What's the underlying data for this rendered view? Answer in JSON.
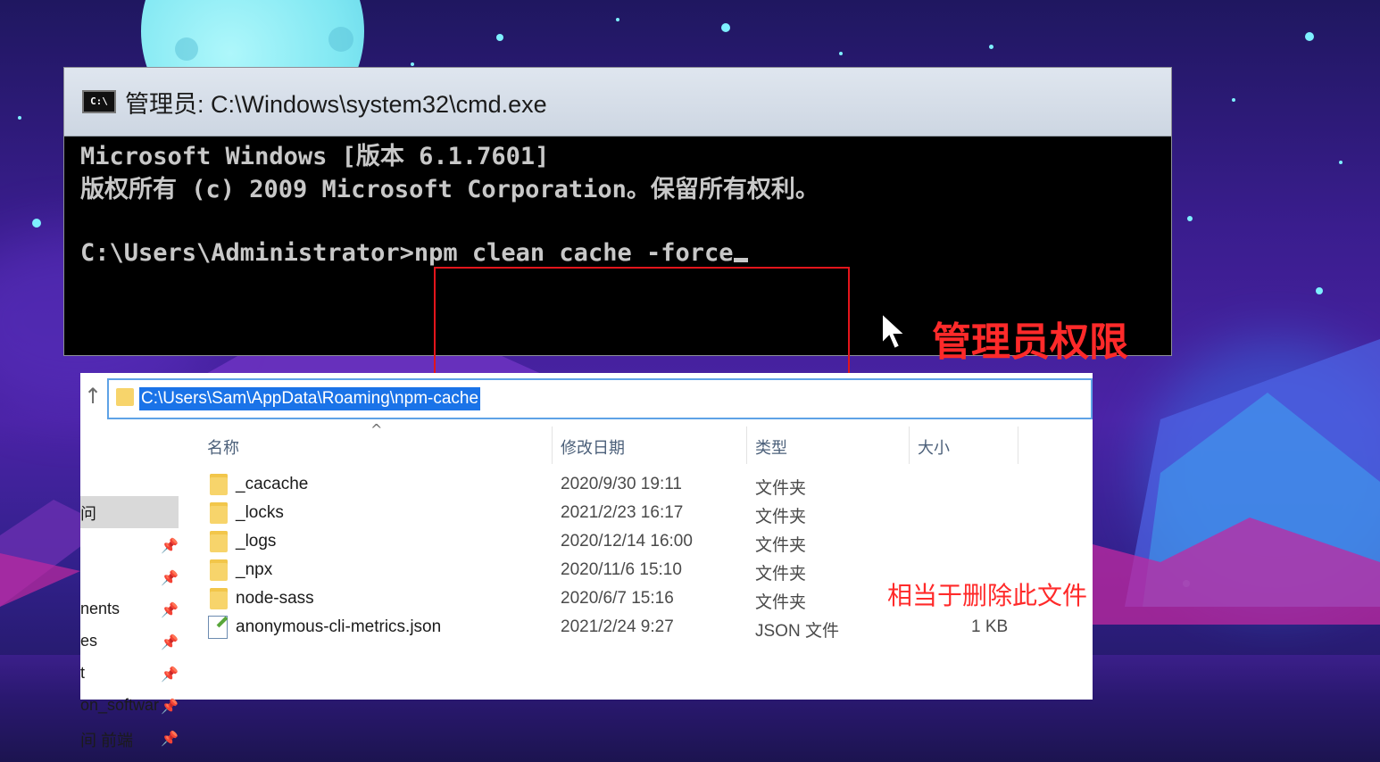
{
  "cmd": {
    "title": "管理员: C:\\Windows\\system32\\cmd.exe",
    "icon_label": "C:\\",
    "lines": [
      "Microsoft Windows [版本 6.1.7601]",
      "版权所有 (c) 2009 Microsoft Corporation。保留所有权利。",
      "C:\\Users\\Administrator>npm clean cache -force"
    ],
    "annotation": "管理员权限"
  },
  "explorer": {
    "address": "C:\\Users\\Sam\\AppData\\Roaming\\npm-cache",
    "sidebar": [
      "问",
      "nents",
      "es",
      "t",
      "on_softwar",
      "间 前端"
    ],
    "columns": {
      "name": "名称",
      "date": "修改日期",
      "type": "类型",
      "size": "大小"
    },
    "rows": [
      {
        "name": "_cacache",
        "date": "2020/9/30 19:11",
        "type": "文件夹",
        "size": "",
        "icon": "folder-icon"
      },
      {
        "name": "_locks",
        "date": "2021/2/23 16:17",
        "type": "文件夹",
        "size": "",
        "icon": "folder-icon"
      },
      {
        "name": "_logs",
        "date": "2020/12/14 16:00",
        "type": "文件夹",
        "size": "",
        "icon": "folder-icon"
      },
      {
        "name": "_npx",
        "date": "2020/11/6 15:10",
        "type": "文件夹",
        "size": "",
        "icon": "folder-icon"
      },
      {
        "name": "node-sass",
        "date": "2020/6/7 15:16",
        "type": "文件夹",
        "size": "",
        "icon": "folder-icon"
      },
      {
        "name": "anonymous-cli-metrics.json",
        "date": "2021/2/24 9:27",
        "type": "JSON 文件",
        "size": "1 KB",
        "icon": "json-file-icon"
      }
    ],
    "annotation": "相当于删除此文件"
  },
  "colors": {
    "annotation_red": "#ff2a2a",
    "highlight_box": "#e3151b",
    "address_select": "#1a73e8"
  }
}
